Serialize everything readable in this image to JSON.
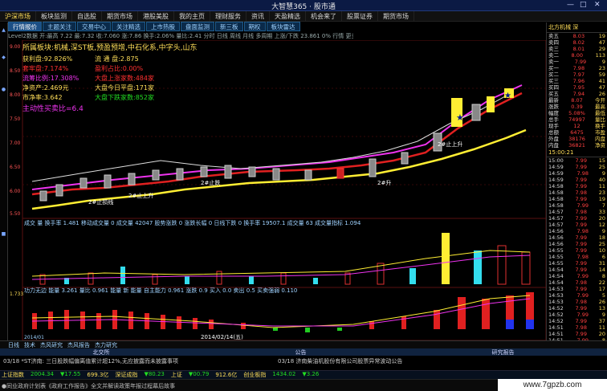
{
  "window": {
    "title": "大智慧365 · 股市通",
    "controls": [
      "—",
      "□",
      "✕"
    ]
  },
  "menu": [
    "沪深市场",
    "板块监测",
    "自选股",
    "期货市场",
    "港股美股",
    "我的主页",
    "理财服务",
    "资讯",
    "天盈精选",
    "机会来了",
    "股票证券",
    "期货市场"
  ],
  "tabs": [
    "行情报价",
    "主题关注",
    "交易中心",
    "关注精选",
    "上市热股",
    "盘面监测",
    "新三板",
    "期权",
    "板块雷达"
  ],
  "infobar": "Level2数据  开:最高 7.22  最:7.32  收:7.060  涨:7.86  换手:2.06%  量比:2.41  分时  日线  周线  月线  多周期  上涨/下跌  23.861 0%  行情  更多",
  "info": {
    "sector_label": "所属板块:机械,深ST板,预盈预增,中石化系,中字头,山东",
    "l1a": "获利盘:92.826%",
    "l1b": "流 通 盘:2.875",
    "l2a": "套牢盘:7.174%",
    "l2b": "盈利占比:0.00%",
    "l3a": "流筹比例:17.308%",
    "l3b": "大盘上涨家数:484家",
    "l4a": "净资产:2.469元",
    "l4b": "大盘今日平盘:171家",
    "l5a": "市净率:3.642",
    "l5b": "大盘下跌家数:852家",
    "l6": "主动性买卖比=6.4"
  },
  "indicators": {
    "vol_label": "成交  量  换手率  1.481  移动成交量  0  成交量  42047  股势涨跌  0  涨跌长幅  0  日线下跌  0  换手率  19507.1  成交量  63  成交量指标 1.094",
    "macd_label": "功力无边  能量  3.261  量比  0.961  能量  新  能量  自主能力  0.961  涨跌  0.9  买入  0.0  卖出  0.5  买卖强弱  0.110",
    "macd_value": "1.733"
  },
  "labels": {
    "a1": "2#止损线",
    "a2": "2#止上升",
    "a3": "2#止跌",
    "a4": "2#止上升",
    "a5": "2#升",
    "date_label": "2014/02/14(五)",
    "date_start": "2014/01"
  },
  "right": {
    "header": "北方机械 深",
    "rows": [
      [
        "卖五",
        "8.03",
        "19"
      ],
      [
        "卖四",
        "8.02",
        "47"
      ],
      [
        "卖三",
        "8.01",
        "29"
      ],
      [
        "卖二",
        "8.00",
        "113"
      ],
      [
        "卖一",
        "7.99",
        "9"
      ],
      [
        "买一",
        "7.98",
        "23"
      ],
      [
        "买二",
        "7.97",
        "59"
      ],
      [
        "买三",
        "7.96",
        "41"
      ],
      [
        "买四",
        "7.95",
        "47"
      ],
      [
        "买五",
        "7.94",
        "26"
      ],
      [
        "最新",
        "8.07",
        "今开"
      ],
      [
        "涨跌",
        "0.39",
        "最高"
      ],
      [
        "幅度",
        "5.08%",
        "最低"
      ],
      [
        "总手",
        "74997",
        "量比"
      ],
      [
        "现手",
        "12",
        "换手"
      ],
      [
        "总额",
        "6475",
        "市盈"
      ],
      [
        "外盘",
        "38176",
        "内盘"
      ],
      [
        "内盘",
        "36821",
        "净资"
      ]
    ],
    "time_header": "15:00:21",
    "ticks": [
      [
        "15:00",
        "7.99",
        "15"
      ],
      [
        "14:59",
        "7.99",
        "25"
      ],
      [
        "14:59",
        "7.98",
        "9"
      ],
      [
        "14:59",
        "7.99",
        "40"
      ],
      [
        "14:58",
        "7.99",
        "11"
      ],
      [
        "14:58",
        "7.98",
        "23"
      ],
      [
        "14:58",
        "7.99",
        "19"
      ],
      [
        "14:58",
        "7.99",
        "7"
      ],
      [
        "14:57",
        "7.98",
        "33"
      ],
      [
        "14:57",
        "7.99",
        "20"
      ],
      [
        "14:57",
        "7.99",
        "12"
      ],
      [
        "14:56",
        "7.98",
        "9"
      ],
      [
        "14:56",
        "7.99",
        "18"
      ],
      [
        "14:56",
        "7.99",
        "25"
      ],
      [
        "14:55",
        "7.99",
        "10"
      ],
      [
        "14:55",
        "7.98",
        "6"
      ],
      [
        "14:55",
        "7.99",
        "31"
      ],
      [
        "14:54",
        "7.99",
        "14"
      ],
      [
        "14:54",
        "7.99",
        "8"
      ],
      [
        "14:54",
        "7.98",
        "22"
      ],
      [
        "14:53",
        "7.99",
        "17"
      ],
      [
        "14:53",
        "7.99",
        "5"
      ],
      [
        "14:53",
        "7.98",
        "26"
      ],
      [
        "14:52",
        "7.99",
        "13"
      ],
      [
        "14:52",
        "7.99",
        "9"
      ],
      [
        "14:52",
        "7.99",
        "37"
      ],
      [
        "14:51",
        "7.98",
        "11"
      ],
      [
        "14:51",
        "7.99",
        "20"
      ],
      [
        "14:51",
        "7.99",
        "8"
      ],
      [
        "14:50",
        "7.99",
        "15"
      ]
    ]
  },
  "bottom_tabs": [
    "日线",
    "技术",
    "杰风研究",
    "杰风报告",
    "杰力研究"
  ],
  "news_hdr": [
    "北交所",
    "公告",
    "研究报告"
  ],
  "news": {
    "n1": "03/18 *ST济南: 三日股跌幅偏离值累计超12%,无应披露而未披露事项",
    "n2": "03/18 济南柴油机股份有限公司股票异常波动公告"
  },
  "ticker": [
    "上证指数",
    "2004.34",
    "▼17.55",
    "699.3亿",
    "深证成指",
    "▼80.23",
    "上证",
    "▼00.79",
    "912.6亿",
    "创业板指",
    "1434.02",
    "▼3.26"
  ],
  "status": "  ●同业政府计划表《政府工作报告》全文并解读政策年报过程幕后故事",
  "watermark": "www.7gpzb.com"
}
